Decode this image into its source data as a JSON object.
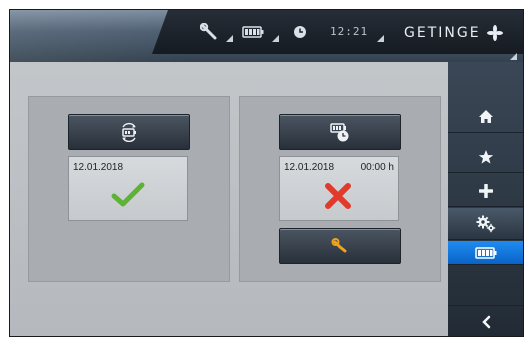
{
  "header": {
    "clock": "12:21",
    "brand": "GETINGE",
    "icons": [
      "wrench-icon",
      "battery-icon",
      "clock-icon",
      "getinge-logo-icon"
    ]
  },
  "left_panel": {
    "button_icon": "battery-cycle-icon",
    "date": "12.01.2018",
    "status_icon": "checkmark-icon",
    "status": "ok"
  },
  "right_panel": {
    "button_icon": "battery-test-icon",
    "date": "12.01.2018",
    "time": "00:00 h",
    "status_icon": "cross-icon",
    "status": "failed",
    "service_icon": "wrench-icon"
  },
  "sidenav": {
    "items": [
      "home-icon",
      "star-icon",
      "plus-icon",
      "settings-gears-icon",
      "battery-icon",
      "",
      "back-arrow-icon"
    ],
    "active": "battery-icon"
  },
  "colors": {
    "accent_blue": "#0a63c7",
    "ok_green": "#5cb335",
    "error_red": "#e23a2a",
    "wrench_orange": "#f0a21b"
  }
}
